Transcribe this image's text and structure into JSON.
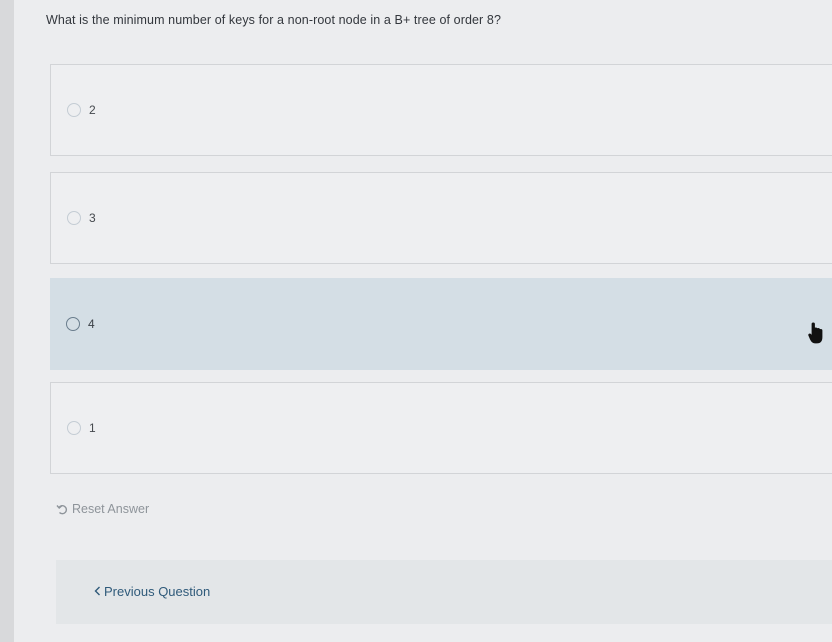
{
  "question": {
    "text": "What is the minimum number of keys for a non-root node in a B+ tree of order 8?"
  },
  "options": [
    {
      "label": "2",
      "selected": false
    },
    {
      "label": "3",
      "selected": false
    },
    {
      "label": "4",
      "selected": true
    },
    {
      "label": "1",
      "selected": false
    }
  ],
  "actions": {
    "reset_label": "Reset Answer",
    "reset_icon": "undo-icon",
    "previous_label": "Previous Question",
    "previous_icon": "chevron-left-icon"
  },
  "cursor": {
    "icon": "hand-pointer-icon"
  },
  "colors": {
    "selected_bg": "#d4dee5",
    "link": "#2f5a7a",
    "muted": "#8e949a"
  }
}
